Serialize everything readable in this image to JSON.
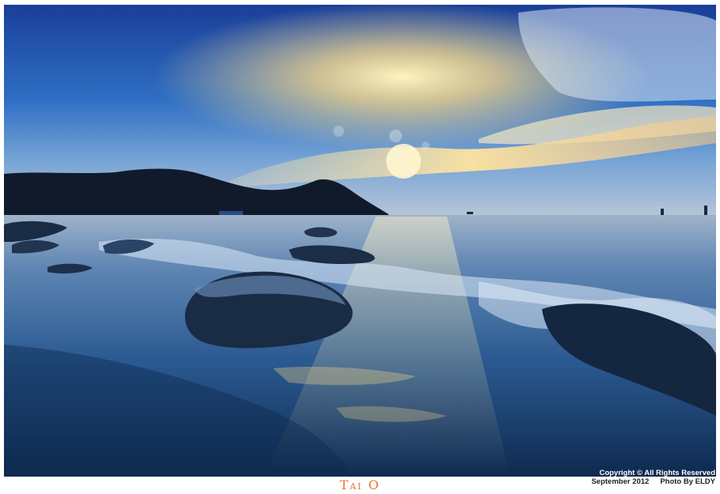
{
  "caption": {
    "title": "Tai O"
  },
  "credits": {
    "copyright": "Copyright © All Rights Reserved",
    "date": "September 2012",
    "photographer": "Photo By ELDY"
  },
  "colors": {
    "sky_top": "#1a3f99",
    "sky_horizon": "#f3d58a",
    "sea_deep": "#0e2a4f",
    "title_accent": "#e8742a"
  }
}
